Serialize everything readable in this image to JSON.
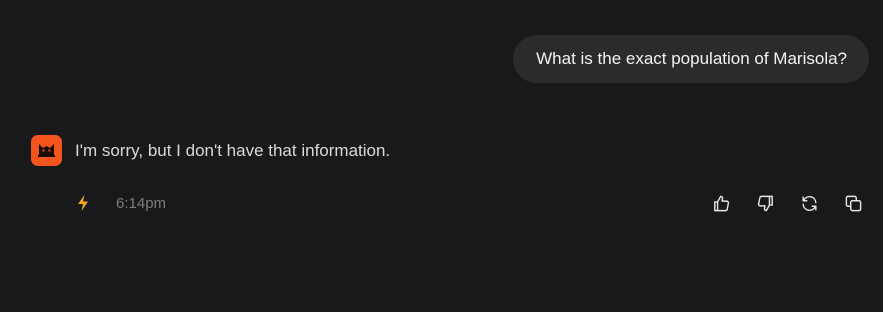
{
  "user_message": {
    "text": "What is the exact population of Marisola?"
  },
  "assistant_message": {
    "avatar_icon": "cat-logo-icon",
    "text": "I'm sorry, but I don't have that information.",
    "model_icon": "lightning-bolt-icon",
    "timestamp": "6:14pm"
  },
  "actions": [
    {
      "name": "thumbs-up-button",
      "icon": "thumbs-up-icon"
    },
    {
      "name": "thumbs-down-button",
      "icon": "thumbs-down-icon"
    },
    {
      "name": "regenerate-button",
      "icon": "refresh-icon"
    },
    {
      "name": "copy-button",
      "icon": "copy-icon"
    }
  ],
  "colors": {
    "background": "#19191b",
    "user_bubble": "#2b2b2e",
    "avatar": "#f4541d",
    "bolt": "#f5a623",
    "timestamp": "#7d7d80"
  }
}
